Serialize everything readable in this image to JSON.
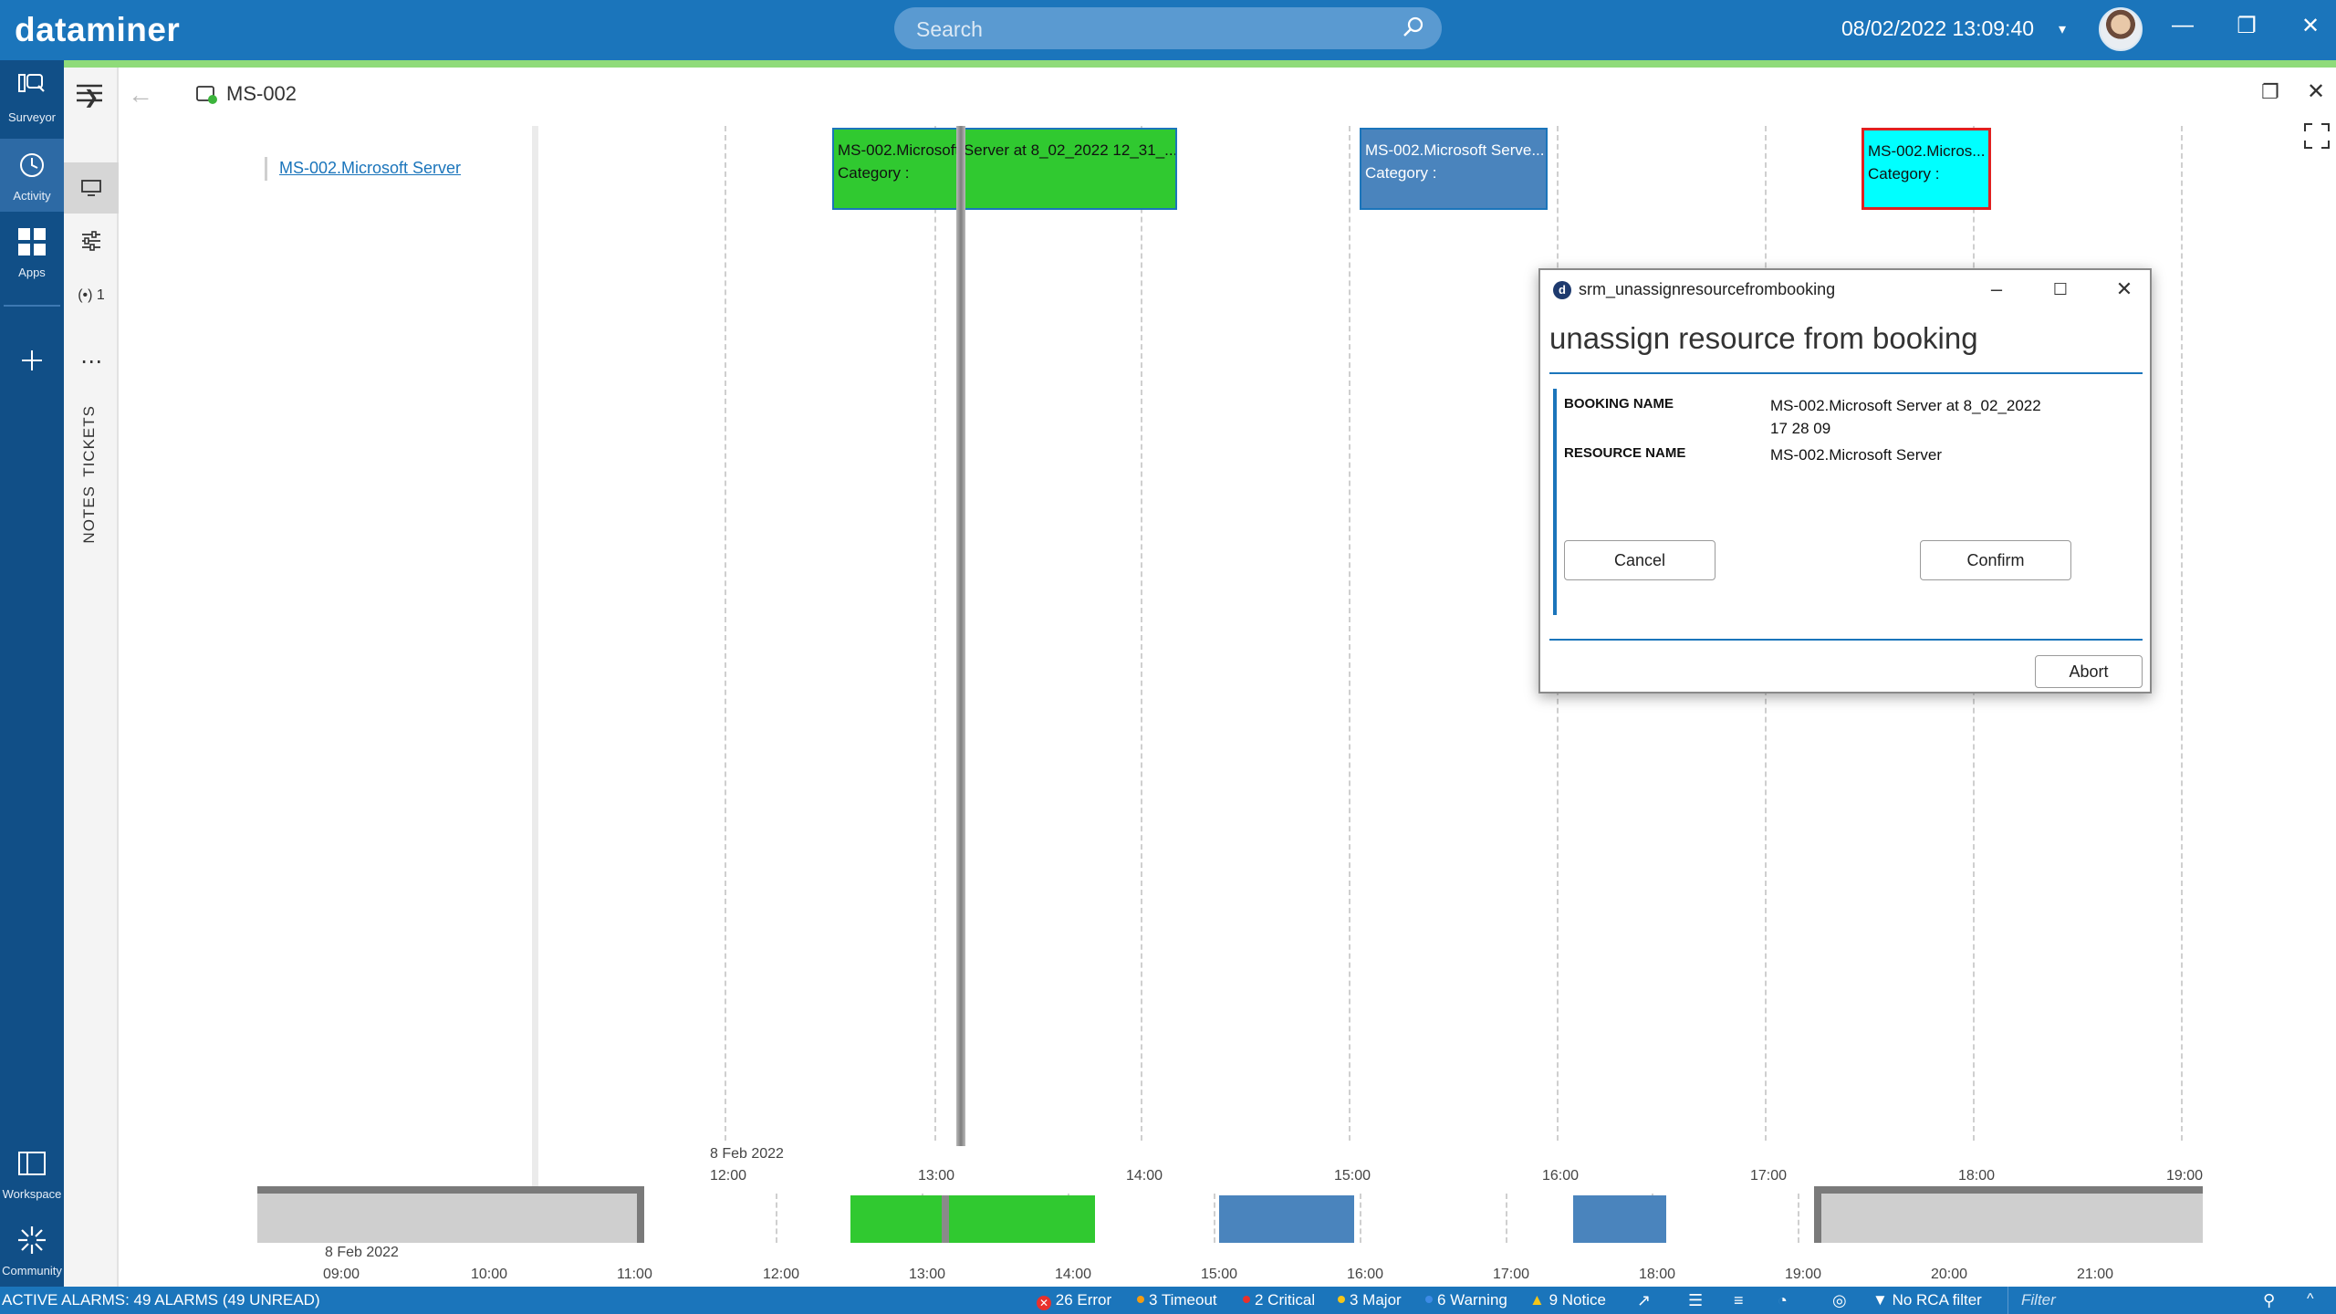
{
  "app": {
    "brand": "dataminer"
  },
  "search": {
    "placeholder": "Search"
  },
  "header": {
    "datetime": "08/02/2022 13:09:40"
  },
  "rail": [
    {
      "label": "Surveyor"
    },
    {
      "label": "Activity"
    },
    {
      "label": "Apps"
    }
  ],
  "rail_bottom": {
    "workspace": "Workspace",
    "community": "Community"
  },
  "toolbar2": {
    "monitor_count": "1",
    "tickets": "TICKETS",
    "notes": "NOTES"
  },
  "page": {
    "title": "MS-002"
  },
  "timeline": {
    "resource": "MS-002.Microsoft Server",
    "bookings": [
      {
        "title": "MS-002.Microsoft Server at 8_02_2022 12_31_...",
        "category": "Category :",
        "color": "#30c930"
      },
      {
        "title": "MS-002.Microsoft Serve...",
        "category": "Category :",
        "color": "#4a84bd"
      },
      {
        "title": "MS-002.Micros...",
        "category": "Category :",
        "color": "#00ffff"
      }
    ],
    "top_date": "8 Feb 2022",
    "top_ticks": [
      "12:00",
      "13:00",
      "14:00",
      "15:00",
      "16:00",
      "17:00",
      "18:00",
      "19:00"
    ],
    "bottom_date": "8 Feb 2022",
    "bottom_ticks": [
      "09:00",
      "10:00",
      "11:00",
      "12:00",
      "13:00",
      "14:00",
      "15:00",
      "16:00",
      "17:00",
      "18:00",
      "19:00",
      "20:00",
      "21:00"
    ]
  },
  "dialog": {
    "window_title": "srm_unassignresourcefrombooking",
    "heading": "unassign resource from booking",
    "booking_name_label": "BOOKING NAME",
    "booking_name_value_line1": "MS-002.Microsoft Server at 8_02_2022",
    "booking_name_value_line2": "17 28 09",
    "resource_name_label": "RESOURCE NAME",
    "resource_name_value": "MS-002.Microsoft Server",
    "cancel": "Cancel",
    "confirm": "Confirm",
    "abort": "Abort"
  },
  "status": {
    "active_alarms": "ACTIVE ALARMS: 49 ALARMS (49 UNREAD)",
    "error": "26 Error",
    "timeout": "3 Timeout",
    "critical": "2 Critical",
    "major": "3 Major",
    "warning": "6 Warning",
    "notice": "9 Notice",
    "rca": "No RCA filter",
    "filter_placeholder": "Filter"
  },
  "colors": {
    "topbar": "#1b75bb",
    "rail": "#114f87",
    "accent_green": "#8fdb7a",
    "error": "#e8312c",
    "timeout": "#f39c12",
    "critical": "#e8312c",
    "major": "#f5c518",
    "warning": "#3d8be6",
    "notice": "#f5c518"
  }
}
